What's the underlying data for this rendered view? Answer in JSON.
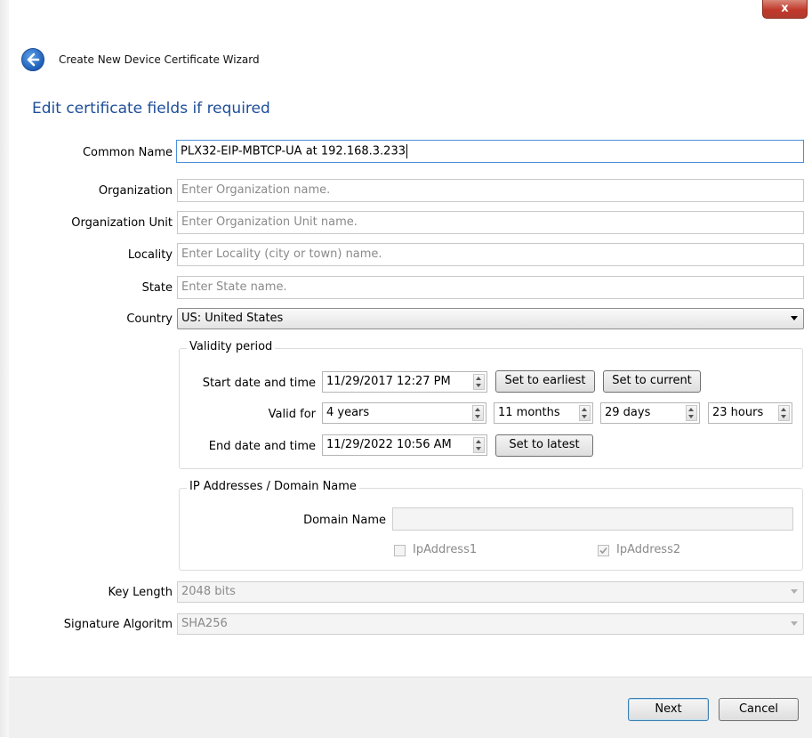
{
  "window": {
    "close_glyph": "x",
    "title": "Create New Device Certificate Wizard"
  },
  "heading": "Edit certificate fields if required",
  "fields": {
    "common_name": {
      "label": "Common Name",
      "value": "PLX32-EIP-MBTCP-UA at 192.168.3.233"
    },
    "organization": {
      "label": "Organization",
      "placeholder": "Enter Organization name."
    },
    "organization_unit": {
      "label": "Organization Unit",
      "placeholder": "Enter Organization Unit name."
    },
    "locality": {
      "label": "Locality",
      "placeholder": "Enter Locality (city or town) name."
    },
    "state": {
      "label": "State",
      "placeholder": "Enter State  name."
    },
    "country": {
      "label": "Country",
      "value": "US: United States"
    }
  },
  "validity": {
    "group_label": "Validity period",
    "start_label": "Start date and time",
    "start_value": "11/29/2017 12:27 PM",
    "set_earliest": "Set to earliest",
    "set_current": "Set to current",
    "valid_for_label": "Valid for",
    "years": "4 years",
    "months": "11 months",
    "days": "29 days",
    "hours": "23 hours",
    "end_label": "End date and time",
    "end_value": "11/29/2022 10:56 AM",
    "set_latest": "Set to latest"
  },
  "ip_group": {
    "group_label": "IP Addresses  / Domain Name",
    "domain_label": "Domain Name",
    "domain_value": "",
    "ip1_label": "IpAddress1",
    "ip1_checked": false,
    "ip2_label": "IpAddress2",
    "ip2_checked": true
  },
  "key_length": {
    "label": "Key Length",
    "value": "2048 bits"
  },
  "signature": {
    "label": "Signature Algoritm",
    "value": "SHA256"
  },
  "footer": {
    "next": "Next",
    "cancel": "Cancel"
  },
  "icons": {
    "back": "back-arrow-icon",
    "close": "close-icon",
    "check": "check-icon"
  }
}
